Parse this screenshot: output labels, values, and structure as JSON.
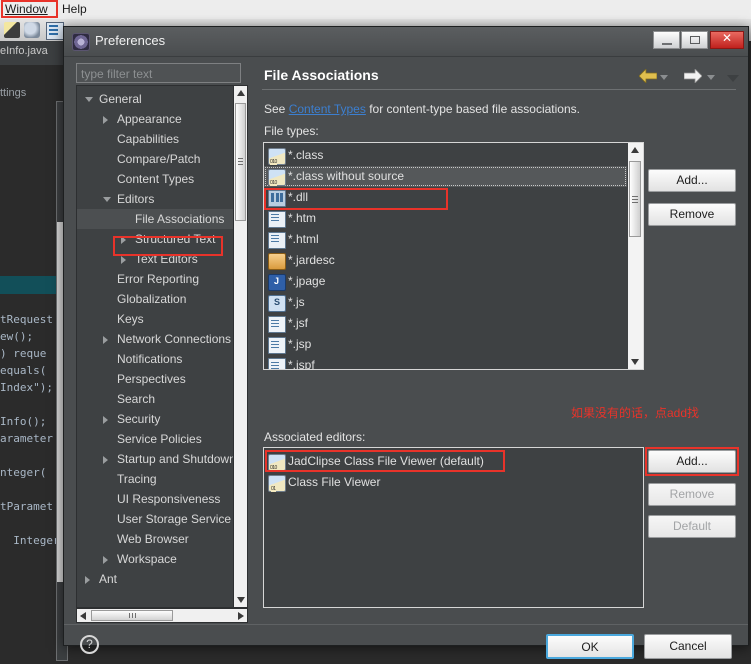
{
  "ide": {
    "menu": [
      {
        "label": "Window",
        "mnemonic": "W",
        "highlighted": true
      },
      {
        "label": "Help",
        "mnemonic": "H",
        "highlighted": false
      }
    ],
    "editor_tab": "eInfo.java",
    "package_text": "ttings",
    "code_lines": [
      "tRequest",
      "ew();",
      ") reque",
      "equals(",
      "Index\");",
      "",
      "Info();",
      "arameter",
      "",
      "nteger(",
      "",
      "tParamet",
      "",
      "  Integer"
    ]
  },
  "dialog": {
    "title": "Preferences",
    "window_buttons": {
      "minimize": "minimize-icon",
      "maximize": "maximize-icon",
      "close": "close-icon"
    },
    "filter": {
      "placeholder": "type filter text",
      "value": ""
    },
    "tree": [
      {
        "label": "General",
        "indent": 0,
        "twisty": "expanded",
        "selected": false
      },
      {
        "label": "Appearance",
        "indent": 1,
        "twisty": "collapsed",
        "selected": false
      },
      {
        "label": "Capabilities",
        "indent": 1,
        "twisty": "none",
        "selected": false
      },
      {
        "label": "Compare/Patch",
        "indent": 1,
        "twisty": "none",
        "selected": false
      },
      {
        "label": "Content Types",
        "indent": 1,
        "twisty": "none",
        "selected": false
      },
      {
        "label": "Editors",
        "indent": 1,
        "twisty": "expanded",
        "selected": false
      },
      {
        "label": "File Associations",
        "indent": 2,
        "twisty": "none",
        "selected": true
      },
      {
        "label": "Structured Text",
        "indent": 2,
        "twisty": "collapsed",
        "selected": false
      },
      {
        "label": "Text Editors",
        "indent": 2,
        "twisty": "collapsed",
        "selected": false
      },
      {
        "label": "Error Reporting",
        "indent": 1,
        "twisty": "none",
        "selected": false
      },
      {
        "label": "Globalization",
        "indent": 1,
        "twisty": "none",
        "selected": false
      },
      {
        "label": "Keys",
        "indent": 1,
        "twisty": "none",
        "selected": false
      },
      {
        "label": "Network Connections",
        "indent": 1,
        "twisty": "collapsed",
        "selected": false
      },
      {
        "label": "Notifications",
        "indent": 1,
        "twisty": "none",
        "selected": false
      },
      {
        "label": "Perspectives",
        "indent": 1,
        "twisty": "none",
        "selected": false
      },
      {
        "label": "Search",
        "indent": 1,
        "twisty": "none",
        "selected": false
      },
      {
        "label": "Security",
        "indent": 1,
        "twisty": "collapsed",
        "selected": false
      },
      {
        "label": "Service Policies",
        "indent": 1,
        "twisty": "none",
        "selected": false
      },
      {
        "label": "Startup and Shutdown",
        "indent": 1,
        "twisty": "collapsed",
        "selected": false
      },
      {
        "label": "Tracing",
        "indent": 1,
        "twisty": "none",
        "selected": false
      },
      {
        "label": "UI Responsiveness",
        "indent": 1,
        "twisty": "none",
        "selected": false
      },
      {
        "label": "User Storage Service",
        "indent": 1,
        "twisty": "none",
        "selected": false
      },
      {
        "label": "Web Browser",
        "indent": 1,
        "twisty": "none",
        "selected": false
      },
      {
        "label": "Workspace",
        "indent": 1,
        "twisty": "collapsed",
        "selected": false
      },
      {
        "label": "Ant",
        "indent": 0,
        "twisty": "collapsed",
        "selected": false
      }
    ],
    "content": {
      "title": "File Associations",
      "see_prefix": "See ",
      "see_link": "Content Types",
      "see_suffix": " for content-type based file associations.",
      "file_types_label": "File types:",
      "file_types": [
        {
          "label": "*.class",
          "icon": "class-file-icon",
          "selected": false
        },
        {
          "label": "*.class without source",
          "icon": "class-file-icon",
          "selected": true
        },
        {
          "label": "*.dll",
          "icon": "dll-file-icon",
          "selected": false
        },
        {
          "label": "*.htm",
          "icon": "html-file-icon",
          "selected": false
        },
        {
          "label": "*.html",
          "icon": "html-file-icon",
          "selected": false
        },
        {
          "label": "*.jardesc",
          "icon": "jar-file-icon",
          "selected": false
        },
        {
          "label": "*.jpage",
          "icon": "jpage-file-icon",
          "selected": false
        },
        {
          "label": "*.js",
          "icon": "js-file-icon",
          "selected": false
        },
        {
          "label": "*.jsf",
          "icon": "jsf-file-icon",
          "selected": false
        },
        {
          "label": "*.jsp",
          "icon": "jsf-file-icon",
          "selected": false
        },
        {
          "label": "*.jspf",
          "icon": "jsf-file-icon",
          "selected": false
        }
      ],
      "file_type_buttons": [
        {
          "label": "Add...",
          "enabled": true,
          "highlighted": false
        },
        {
          "label": "Remove",
          "enabled": true,
          "highlighted": false
        }
      ],
      "annotation_note": "如果没有的话，点add找",
      "assoc_label": "Associated editors:",
      "associated_editors": [
        {
          "label": "JadClipse Class File Viewer (default)",
          "icon": "class-file-icon",
          "highlighted": true
        },
        {
          "label": "Class File Viewer",
          "icon": "class-viewer-icon",
          "highlighted": false
        }
      ],
      "editor_buttons": [
        {
          "label": "Add...",
          "enabled": true,
          "highlighted": true
        },
        {
          "label": "Remove",
          "enabled": false,
          "highlighted": false
        },
        {
          "label": "Default",
          "enabled": false,
          "highlighted": false
        }
      ],
      "nav_back": "back-arrow-icon",
      "nav_forward": "forward-arrow-icon"
    },
    "footer": {
      "help": "?",
      "ok": "OK",
      "cancel": "Cancel"
    }
  },
  "colors": {
    "accent_red": "#e8332a",
    "link_blue": "#3c7fd0",
    "ok_focus_blue": "#4aa8dd",
    "dialog_bg": "#4a4d4f",
    "list_bg": "#3e4143"
  }
}
